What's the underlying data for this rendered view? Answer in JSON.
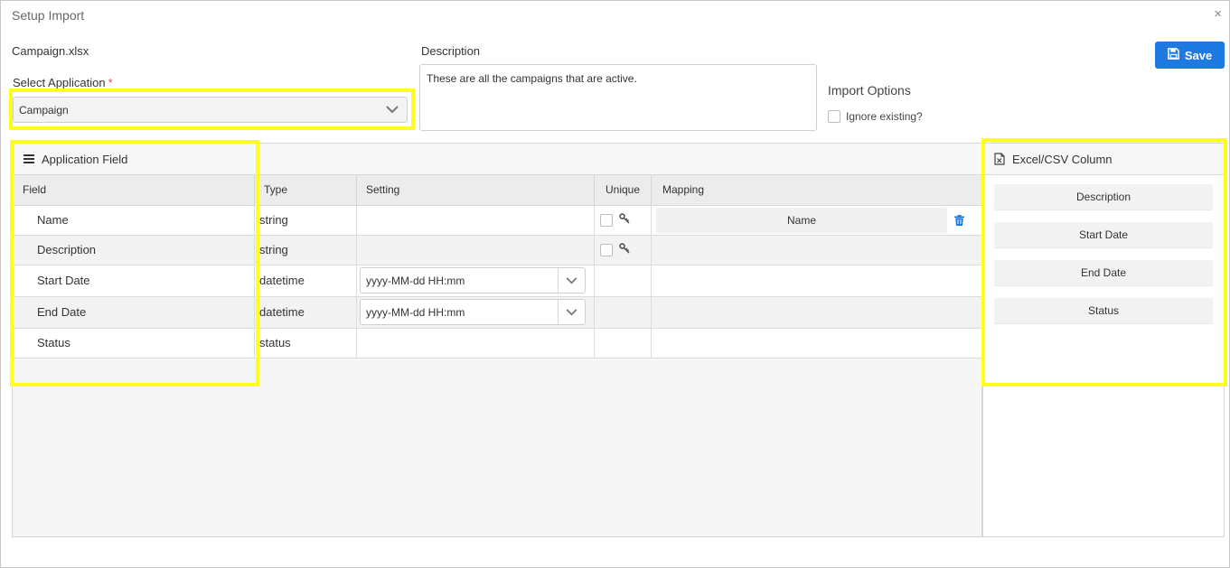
{
  "dialog": {
    "title": "Setup Import",
    "close_glyph": "×"
  },
  "file": {
    "name": "Campaign.xlsx"
  },
  "select_application": {
    "label": "Select Application",
    "required_mark": "*",
    "value": "Campaign"
  },
  "description": {
    "label": "Description",
    "value": "These are all the campaigns that are active."
  },
  "import_options": {
    "title": "Import Options",
    "ignore_existing_label": "Ignore existing?",
    "ignore_existing_checked": false
  },
  "toolbar": {
    "save_label": "Save"
  },
  "application_field_panel": {
    "title": "Application Field",
    "icon": "hamburger-icon",
    "columns": [
      "Field",
      "Type",
      "Setting",
      "Unique",
      "Mapping"
    ],
    "rows": [
      {
        "field": "Name",
        "type": "string",
        "setting": "",
        "unique": true,
        "mapping": "Name"
      },
      {
        "field": "Description",
        "type": "string",
        "setting": "",
        "unique": true,
        "mapping": ""
      },
      {
        "field": "Start Date",
        "type": "datetime",
        "setting": "yyyy-MM-dd HH:mm",
        "unique": false,
        "mapping": ""
      },
      {
        "field": "End Date",
        "type": "datetime",
        "setting": "yyyy-MM-dd HH:mm",
        "unique": false,
        "mapping": ""
      },
      {
        "field": "Status",
        "type": "status",
        "setting": "",
        "unique": false,
        "mapping": ""
      }
    ]
  },
  "excel_panel": {
    "title": "Excel/CSV Column",
    "icon": "excel-file-icon",
    "columns": [
      "Description",
      "Start Date",
      "End Date",
      "Status"
    ]
  },
  "colors": {
    "primary": "#1e7ae0",
    "highlight": "#ffff1e",
    "required": "#d9534f"
  }
}
